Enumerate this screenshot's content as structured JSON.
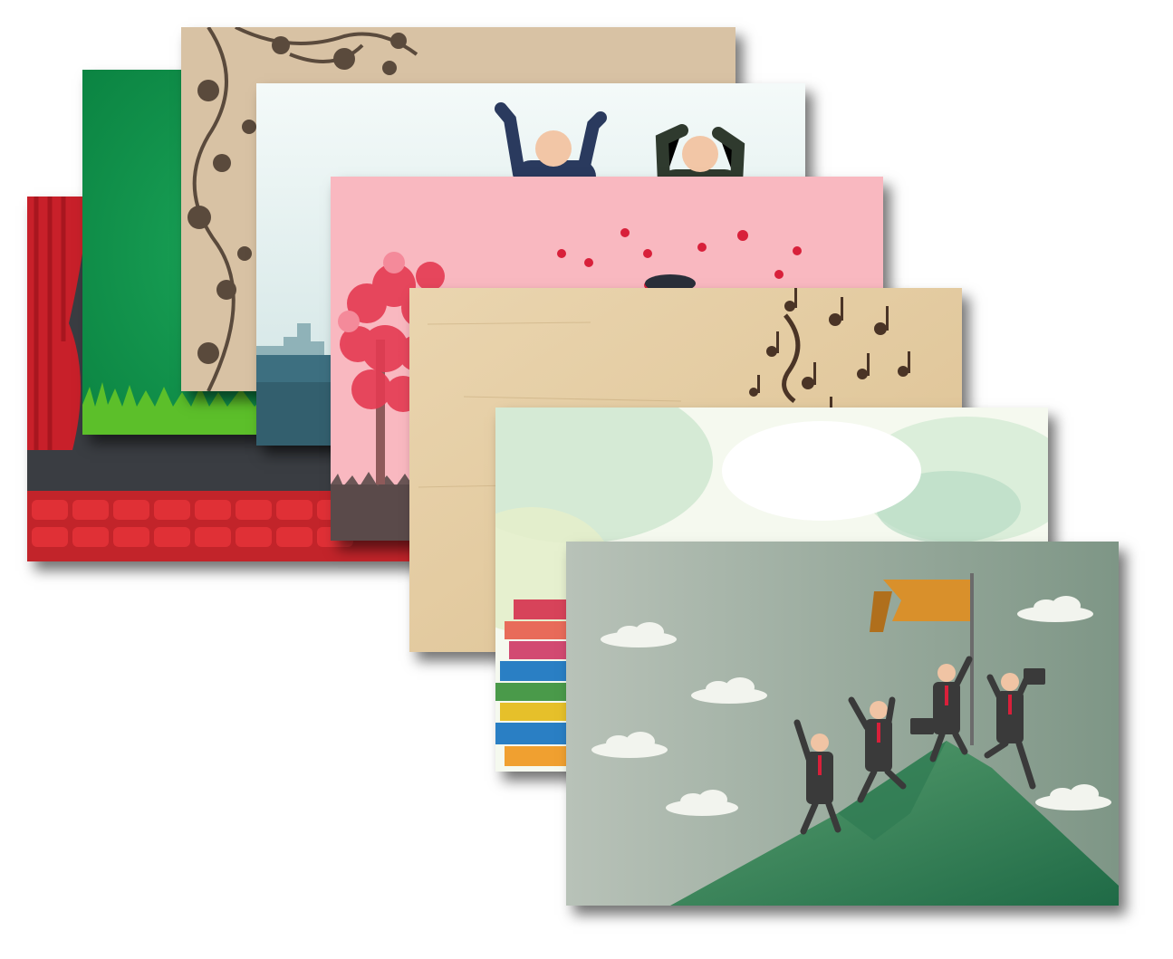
{
  "gallery": {
    "cards": [
      {
        "theme": "theater-stage",
        "colors": {
          "bg": "#3a3d42",
          "curtain": "#c8202a",
          "seats": "#d42a2e"
        }
      },
      {
        "theme": "green-grass",
        "colors": {
          "bg": "#0f8f4a",
          "grass": "#5cbf2a"
        }
      },
      {
        "theme": "floral-ornament",
        "colors": {
          "bg": "#d8c2a4",
          "ornament": "#5a4a3c"
        }
      },
      {
        "theme": "celebrating-businessmen",
        "colors": {
          "bg": "#e8f3f2",
          "city": "#3d6f80"
        }
      },
      {
        "theme": "love-tree-hearts",
        "colors": {
          "bg": "#f9b8c0",
          "hearts": "#d8203a"
        }
      },
      {
        "theme": "vintage-music-notes",
        "colors": {
          "bg": "#e7cfa6",
          "notes": "#4a3426"
        }
      },
      {
        "theme": "watercolor-books",
        "colors": {
          "bg": "#eaf3e2",
          "splash": "#b8dcc4"
        }
      },
      {
        "theme": "mountain-summit-team",
        "colors": {
          "bg": "#aab6ac",
          "mountain": "#3f8a5f",
          "flag": "#d9902b"
        }
      }
    ]
  }
}
